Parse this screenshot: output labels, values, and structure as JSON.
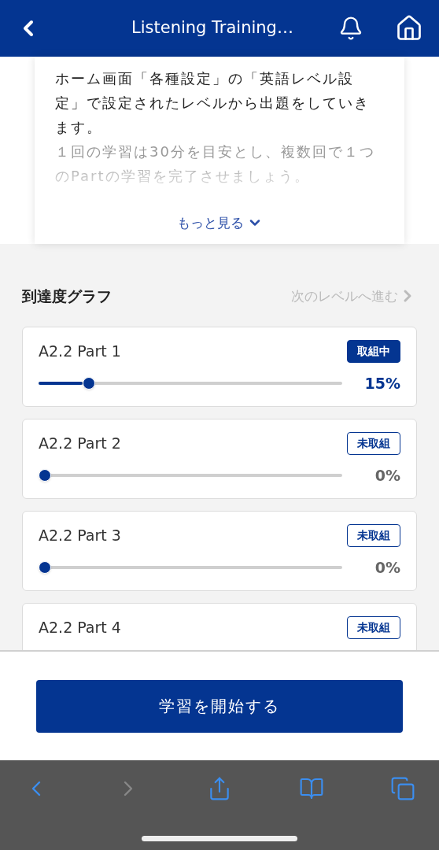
{
  "header": {
    "title": "Listening Training…"
  },
  "description": {
    "paragraphs": [
      "ホーム画面「各種設定」の「英語レベル設定」で設定されたレベルから出題をしていきます。",
      "１回の学習は30分を目安とし、複数回で１つのPartの学習を完了させましょう。"
    ],
    "more": "もっと見る"
  },
  "graph": {
    "title": "到達度グラフ",
    "next": "次のレベルへ進む"
  },
  "parts": [
    {
      "name": "A2.2 Part 1",
      "status": "取組中",
      "kind": "active",
      "level": 0.15,
      "percent": "15%"
    },
    {
      "name": "A2.2 Part 2",
      "status": "未取組",
      "kind": "idle",
      "level": 0,
      "percent": "0%"
    },
    {
      "name": "A2.2 Part 3",
      "status": "未取組",
      "kind": "idle",
      "level": 0,
      "percent": "0%"
    },
    {
      "name": "A2.2 Part 4",
      "status": "未取組",
      "kind": "idle"
    }
  ],
  "start_button": "学習を開始する"
}
